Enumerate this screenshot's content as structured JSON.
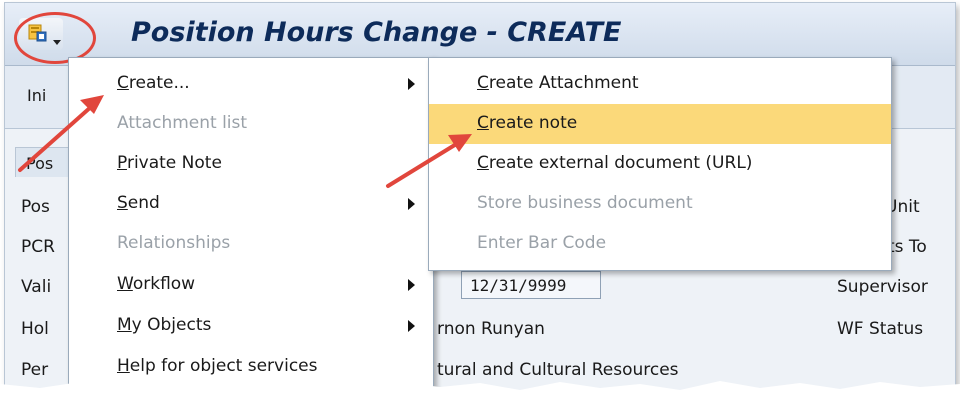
{
  "window": {
    "title": "Position Hours Change - CREATE",
    "toolbar_button_partial": "Ini"
  },
  "form": {
    "tab_partial": "Pos",
    "left_labels": [
      "Pos",
      "PCR",
      "Vali",
      "Hol",
      "Per"
    ],
    "date_value": "12/31/9999",
    "holder_partial": "rnon Runyan",
    "personnel_partial": "tural and Cultural Resources",
    "right_labels": [
      "Unit",
      "rts To",
      "Supervisor",
      "WF Status"
    ]
  },
  "main_menu": {
    "items": [
      {
        "label": "Create...",
        "accel": "C",
        "rest": "reate...",
        "disabled": false,
        "active": false,
        "submenu": true
      },
      {
        "label": "Attachment list",
        "accel": "A",
        "rest": "ttachment list",
        "disabled": true,
        "active": false,
        "submenu": false
      },
      {
        "label": "Private Note",
        "accel": "P",
        "rest": "rivate Note",
        "disabled": false,
        "active": false,
        "submenu": false
      },
      {
        "label": "Send",
        "accel": "S",
        "rest": "end",
        "disabled": false,
        "active": false,
        "submenu": true
      },
      {
        "label": "Relationships",
        "accel": "",
        "rest": "Relationships",
        "disabled": true,
        "active": false,
        "submenu": false
      },
      {
        "label": "Workflow",
        "accel": "W",
        "rest": "orkflow",
        "disabled": false,
        "active": false,
        "submenu": true
      },
      {
        "label": "My Objects",
        "accel": "M",
        "rest": "y Objects",
        "disabled": false,
        "active": false,
        "submenu": true
      },
      {
        "label": "Help for object services",
        "accel": "H",
        "rest": "elp for object services",
        "disabled": false,
        "active": false,
        "submenu": false
      }
    ]
  },
  "sub_menu": {
    "items": [
      {
        "label": "Create Attachment",
        "accel": "C",
        "rest": "reate Attachment",
        "disabled": false,
        "active": false
      },
      {
        "label": "Create note",
        "accel": "C",
        "rest": "reate note",
        "disabled": false,
        "active": true
      },
      {
        "label": "Create external document (URL)",
        "accel": "C",
        "rest": "reate external document (URL)",
        "disabled": false,
        "active": false
      },
      {
        "label": "Store business document",
        "accel": "S",
        "rest": "tore business document",
        "disabled": true,
        "active": false
      },
      {
        "label": "Enter Bar Code",
        "accel": "E",
        "rest": "nter Bar Code",
        "disabled": true,
        "active": false
      }
    ]
  },
  "icons": {
    "services": "object-services-icon",
    "annotation": "red-arrow"
  },
  "colors": {
    "highlight": "#fbd97a",
    "annotation": "#e1463c",
    "title_text": "#0d2b5a"
  }
}
